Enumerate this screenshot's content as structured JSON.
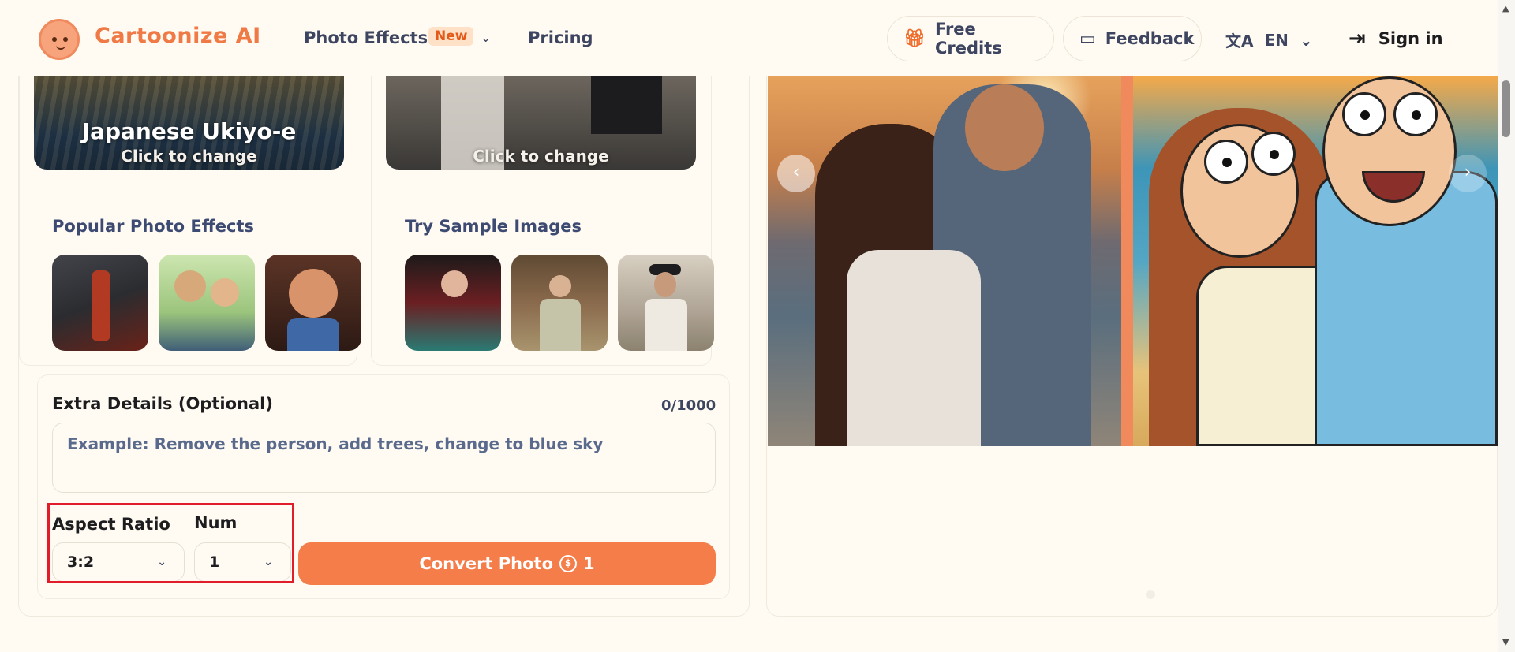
{
  "header": {
    "brand": "Cartoonize AI",
    "nav_photo_effects": "Photo Effects",
    "nav_new_badge": "New",
    "nav_pricing": "Pricing",
    "free_credits": "Free Credits",
    "feedback": "Feedback",
    "language": "EN",
    "sign_in": "Sign in"
  },
  "style_cards": {
    "selected_style": "Japanese Ukiyo-e",
    "click_to_change_1": "Click to change",
    "click_to_change_2": "Click to change"
  },
  "sections": {
    "popular_title": "Popular Photo Effects",
    "samples_title": "Try Sample Images"
  },
  "extra_details": {
    "label": "Extra Details (Optional)",
    "count": "0/1000",
    "placeholder": "Example: Remove the person, add trees, change to blue sky",
    "value": ""
  },
  "options": {
    "aspect_label": "Aspect Ratio",
    "aspect_value": "3:2",
    "num_label": "Num",
    "num_value": "1"
  },
  "convert": {
    "label": "Convert Photo",
    "cost": "1"
  },
  "colors": {
    "brand": "#f07a45",
    "button": "#f47d4a",
    "highlight": "#e21d2a",
    "background": "#fffbf3"
  },
  "icons": {
    "logo": "cartoon-face-logo",
    "gift": "gift-icon",
    "chat": "chat-bubble-icon",
    "translate": "translate-icon",
    "signin": "sign-in-icon",
    "chevron": "chevron-down-icon",
    "coin": "coin-icon"
  }
}
